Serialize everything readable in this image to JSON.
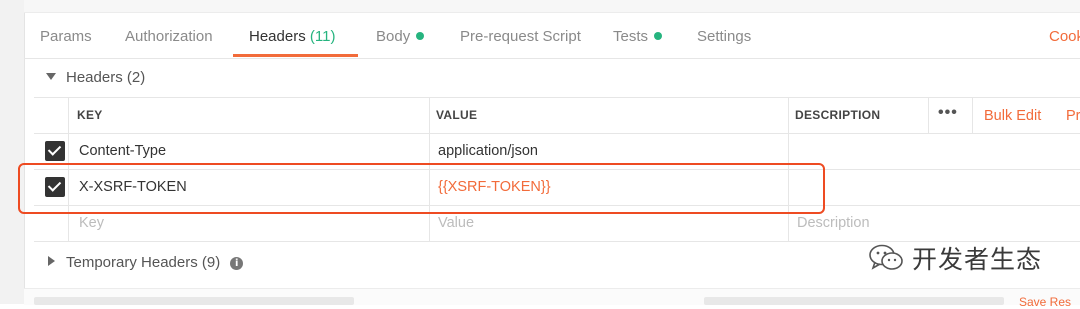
{
  "tabs": [
    {
      "label": "Params"
    },
    {
      "label": "Authorization"
    },
    {
      "label": "Headers",
      "count": "(11)",
      "active": true
    },
    {
      "label": "Body",
      "dot": true
    },
    {
      "label": "Pre-request Script"
    },
    {
      "label": "Tests",
      "dot": true
    },
    {
      "label": "Settings"
    },
    {
      "label": "Cook"
    }
  ],
  "headers_section": {
    "label": "Headers (2)"
  },
  "table": {
    "columns": {
      "key": "KEY",
      "value": "VALUE",
      "description": "DESCRIPTION"
    },
    "more_label": "•••",
    "bulk_edit_label": "Bulk Edit",
    "presets_label": "Pr",
    "rows": [
      {
        "key": "Content-Type",
        "value": "application/json",
        "description": ""
      },
      {
        "key": "X-XSRF-TOKEN",
        "value": "{{XSRF-TOKEN}}",
        "description": ""
      }
    ],
    "placeholders": {
      "key": "Key",
      "value": "Value",
      "description": "Description"
    }
  },
  "temporary_section": {
    "label": "Temporary Headers (9)"
  },
  "watermark": {
    "text": "开发者生态"
  },
  "status": {
    "save_label": "Save Res"
  },
  "colors": {
    "accent": "#f26b3a",
    "green": "#26b47f",
    "highlight": "#ee4b22"
  },
  "icons": [
    "caret-down-icon",
    "caret-right-icon",
    "info-icon",
    "checkbox-checked-icon",
    "wechat-icon"
  ]
}
